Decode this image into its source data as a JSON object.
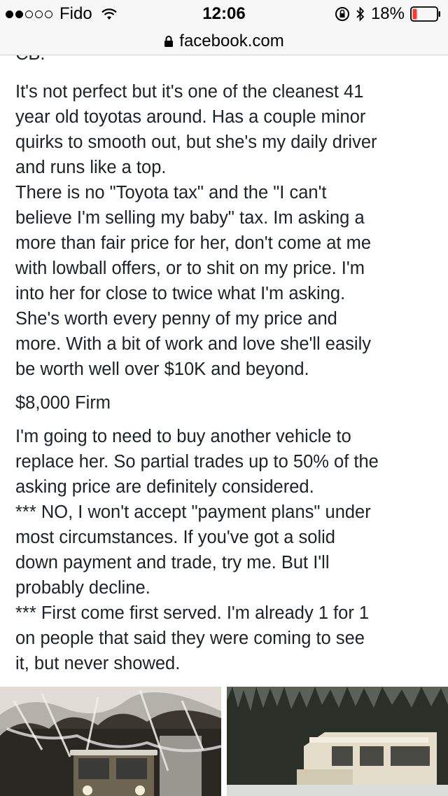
{
  "status_bar": {
    "carrier": "Fido",
    "time": "12:06",
    "battery_percent": "18%",
    "signal_bars_filled": 2,
    "signal_bars_total": 5,
    "battery_level": 0.18,
    "battery_color": "#ff3b30"
  },
  "browser": {
    "url": "facebook.com"
  },
  "post": {
    "partial_top_text": "CB.",
    "paragraph1": "It's not perfect but it's one of the cleanest 41\nyear old toyotas around. Has a couple minor\nquirks to smooth out, but she's my daily driver\nand runs like a top.\nThere is no \"Toyota tax\" and the \"I can't\nbelieve I'm selling my baby\" tax. Im asking a\nmore than fair price for her, don't come at me\nwith lowball offers, or to shit on my price. I'm\ninto her for close to twice what I'm asking.\nShe's worth every penny of my price and\nmore. With a bit of work and love she'll easily\nbe worth well over $10K and beyond.",
    "price": "$8,000 Firm",
    "paragraph2": "I'm going to need to buy another vehicle to\nreplace her. So partial trades up to 50% of the\nasking price are definitely considered.\n*** NO, I won't accept \"payment plans\" under\nmost circumstances. If you've got a solid\ndown payment and trade, try me. But I'll\nprobably decline.\n*** First come first served. I'm already 1 for 1\non people that said they were coming to see\nit, but never showed."
  }
}
